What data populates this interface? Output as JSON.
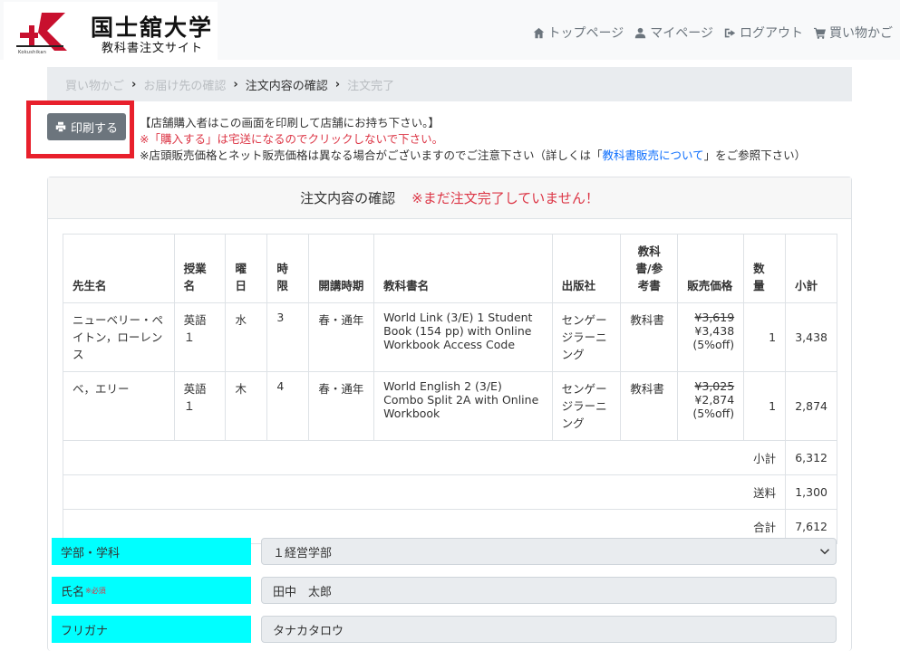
{
  "header": {
    "logo_title": "国士舘大学",
    "logo_subtitle": "教科書注文サイト",
    "logo_sub": "Kokushikan",
    "nav": [
      {
        "label": "トップページ",
        "icon": "home-icon"
      },
      {
        "label": "マイページ",
        "icon": "user-icon"
      },
      {
        "label": "ログアウト",
        "icon": "logout-icon"
      },
      {
        "label": "買い物かご",
        "icon": "cart-icon"
      }
    ]
  },
  "breadcrumb": {
    "items": [
      "買い物かご",
      "お届け先の確認",
      "注文内容の確認",
      "注文完了"
    ],
    "current_index": 2
  },
  "print_button": {
    "label": "印刷する",
    "icon": "print-icon"
  },
  "notes": {
    "line1": "【店舗購入者はこの画面を印刷して店舗にお持ち下さい。】",
    "line2": "※「購入する」は宅送になるのでクリックしないで下さい。",
    "line3_pre": "※店頭販売価格とネット販売価格は異なる場合がございますのでご注意下さい（詳しくは「",
    "line3_link": "教科書販売について",
    "line3_post": "」をご参照下さい）"
  },
  "card": {
    "title": "注文内容の確認",
    "warning": "※まだ注文完了していません！"
  },
  "table": {
    "headers": [
      "先生名",
      "授業名",
      "曜日",
      "時限",
      "開講時期",
      "教科書名",
      "出版社",
      "教科書/参考書",
      "販売価格",
      "数量",
      "小計"
    ],
    "rows": [
      {
        "teacher": "ニューベリー・ペイトン，ローレンス",
        "course": "英語１",
        "day": "水",
        "period": "3",
        "term": "春・通年",
        "book": "World Link (3/E) 1 Student Book (154 pp) with Online Workbook Access Code",
        "publisher": "センゲージラーニング",
        "type": "教科書",
        "list_price": "¥3,619",
        "sale_price": "¥3,438",
        "discount": "(5%off)",
        "qty": "1",
        "subtotal": "3,438"
      },
      {
        "teacher": "ベ，エリー",
        "course": "英語１",
        "day": "木",
        "period": "4",
        "term": "春・通年",
        "book": "World English 2 (3/E) Combo Split 2A with Online Workbook",
        "publisher": "センゲージラーニング",
        "type": "教科書",
        "list_price": "¥3,025",
        "sale_price": "¥2,874",
        "discount": "(5%off)",
        "qty": "1",
        "subtotal": "2,874"
      }
    ],
    "summary": [
      {
        "label": "小計",
        "value": "6,312"
      },
      {
        "label": "送料",
        "value": "1,300"
      },
      {
        "label": "合計",
        "value": "7,612"
      }
    ]
  },
  "form": {
    "faculty_label": "学部・学科",
    "faculty_value": "１経営学部",
    "name_label": "氏名",
    "name_required": "※必須",
    "name_value": "田中　太郎",
    "kana_label": "フリガナ",
    "kana_value": "タナカタロウ"
  },
  "colors": {
    "accent_red": "#dc3545",
    "highlight_frame": "#e8202c",
    "label_bg": "#00ffff",
    "button_gray": "#6c757d",
    "link_blue": "#0d6efd"
  }
}
